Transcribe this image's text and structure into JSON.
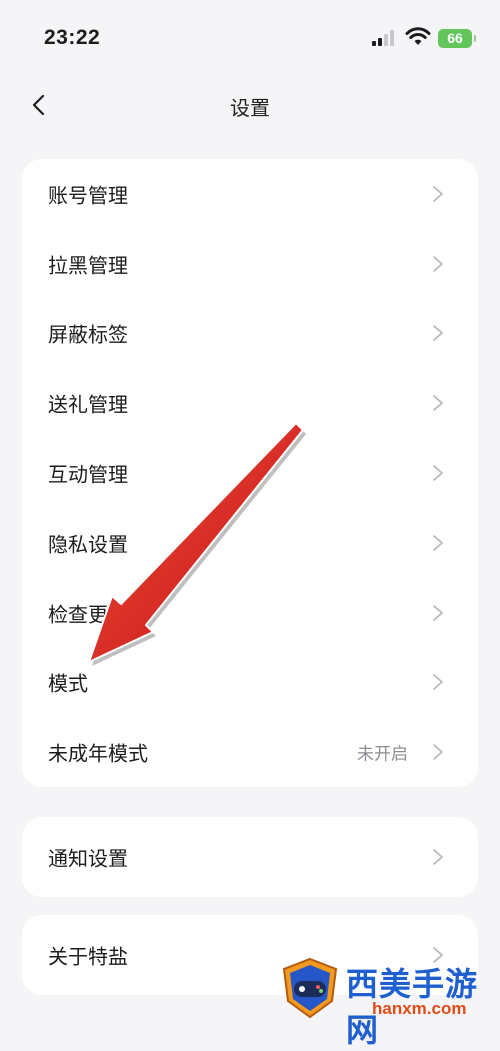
{
  "status_bar": {
    "time": "23:22",
    "battery": "66"
  },
  "nav": {
    "title": "设置"
  },
  "groups": [
    {
      "items": [
        {
          "label": "账号管理"
        },
        {
          "label": "拉黑管理"
        },
        {
          "label": "屏蔽标签"
        },
        {
          "label": "送礼管理"
        },
        {
          "label": "互动管理"
        },
        {
          "label": "隐私设置"
        },
        {
          "label": "检查更"
        },
        {
          "label": "模式"
        },
        {
          "label": "未成年模式",
          "value": "未开启"
        }
      ]
    },
    {
      "items": [
        {
          "label": "通知设置"
        }
      ]
    },
    {
      "items": [
        {
          "label": "关于特盐"
        }
      ]
    }
  ],
  "watermark": {
    "title": "西美手游网",
    "url": "hanxm.com"
  },
  "colors": {
    "arrow": "#d91c1c",
    "battery": "#62c65a",
    "watermark_title": "#1f5fd0",
    "watermark_url": "#e04b18"
  },
  "icons": [
    "back-chevron-icon",
    "chevron-right-icon",
    "signal-icon",
    "wifi-icon",
    "battery-icon"
  ]
}
